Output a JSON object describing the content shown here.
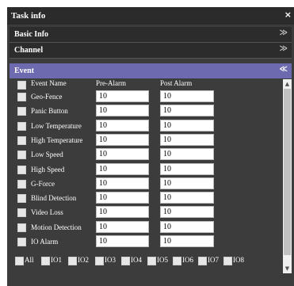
{
  "dialog": {
    "title": "Task info",
    "close_glyph": "×"
  },
  "sections": {
    "basic_info": {
      "label": "Basic Info",
      "chevron": "≫"
    },
    "channel": {
      "label": "Channel",
      "chevron": "≫"
    },
    "event": {
      "label": "Event",
      "chevron": "≪"
    }
  },
  "event_table": {
    "headers": {
      "name": "Event Name",
      "pre": "Pre-Alarm",
      "post": "Post Alarm"
    },
    "rows": [
      {
        "name": "Geo-Fence",
        "pre": "10",
        "post": "10"
      },
      {
        "name": "Panic Button",
        "pre": "10",
        "post": "10"
      },
      {
        "name": "Low Temperature",
        "pre": "10",
        "post": "10"
      },
      {
        "name": "High Temperature",
        "pre": "10",
        "post": "10"
      },
      {
        "name": "Low Speed",
        "pre": "10",
        "post": "10"
      },
      {
        "name": "High Speed",
        "pre": "10",
        "post": "10"
      },
      {
        "name": "G-Force",
        "pre": "10",
        "post": "10"
      },
      {
        "name": "Blind Detection",
        "pre": "10",
        "post": "10"
      },
      {
        "name": "Video Loss",
        "pre": "10",
        "post": "10"
      },
      {
        "name": "Motion Detection",
        "pre": "10",
        "post": "10"
      },
      {
        "name": "IO Alarm",
        "pre": "10",
        "post": "10"
      }
    ]
  },
  "io_options": [
    "All",
    "IO1",
    "IO2",
    "IO3",
    "IO4",
    "IO5",
    "IO6",
    "IO7",
    "IO8"
  ],
  "scrollbar": {
    "up_glyph": "▲",
    "down_glyph": "▼"
  }
}
